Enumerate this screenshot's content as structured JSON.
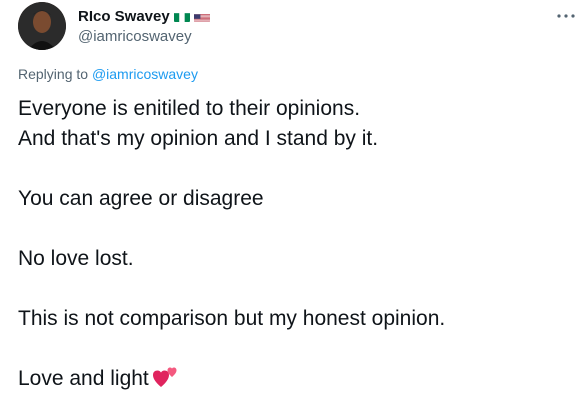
{
  "author": {
    "display_name": "RIco Swavey",
    "handle": "@iamricoswavey",
    "flags": [
      "nigeria-flag-icon",
      "usa-flag-icon"
    ]
  },
  "reply": {
    "prefix": "Replying to ",
    "mention": "@iamricoswavey"
  },
  "tweet": {
    "line1": "Everyone is enitiled to their opinions.",
    "line2": "And that's my opinion and I stand by it.",
    "line3": "You can agree or disagree",
    "line4": "No love lost.",
    "line5": "This is not comparison but my honest opinion.",
    "line6": "Love and light"
  },
  "icons": {
    "more": "more-options-icon",
    "heart": "two-hearts-icon"
  },
  "colors": {
    "text": "#0f1419",
    "secondary": "#536471",
    "link": "#1d9bf0",
    "heart": "#e0245e"
  }
}
